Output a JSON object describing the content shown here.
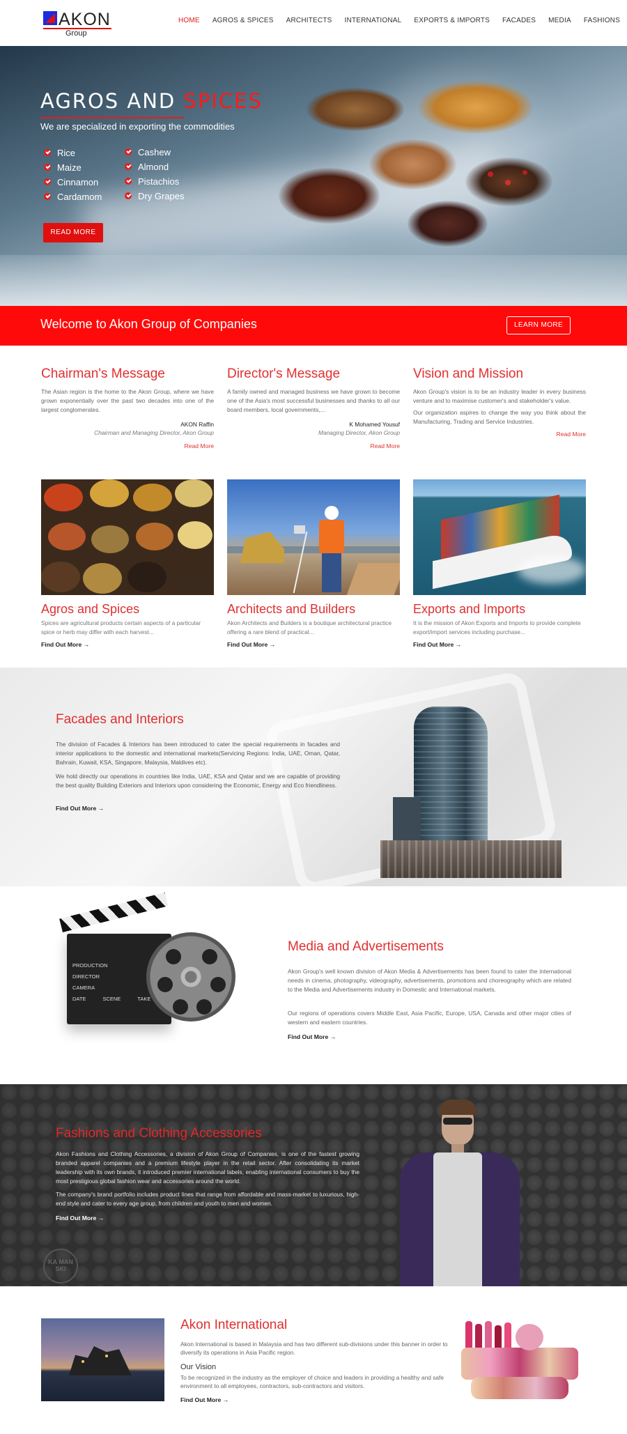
{
  "logo": {
    "word": "AKON",
    "group": "Group"
  },
  "nav": [
    "HOME",
    "AGROS & SPICES",
    "ARCHITECTS",
    "INTERNATIONAL",
    "EXPORTS & IMPORTS",
    "FACADES",
    "MEDIA",
    "FASHIONS"
  ],
  "hero": {
    "title_white": "AGROS AND",
    "title_red": "SPICES",
    "subtitle": "We are specialized in exporting the commodities",
    "list_left": [
      "Rice",
      "Maize",
      "Cinnamon",
      "Cardamom"
    ],
    "list_right": [
      "Cashew",
      "Almond",
      "Pistachios",
      "Dry Grapes"
    ],
    "button": "READ MORE"
  },
  "welcome": {
    "text": "Welcome to Akon Group of Companies",
    "button": "LEARN MORE"
  },
  "messages": [
    {
      "title": "Chairman's Message",
      "body": "The Asian region is the home to the Akon Group, where we have grown exponentially over the past two decades into one of the largest conglomerates.",
      "signature": "AKON Raffin",
      "role": "Chairman and Managing Director, Akon Group",
      "link": "Read More"
    },
    {
      "title": "Director's Message",
      "body": "A family owned and managed business we have grown to become one of the Asia's most successful businesses and thanks to all our board members, local governments,...",
      "signature": "K Mohamed Yousuf",
      "role": "Managing Director, Akon Group",
      "link": "Read More"
    },
    {
      "title": "Vision and Mission",
      "body": "Akon Group's vision is to be an industry leader in every business venture and to maximise customer's and stakeholder's value.",
      "body2": "Our organization aspires to change the way you think about the Manufacturing, Trading and Service Industries.",
      "link": "Read More"
    }
  ],
  "cards": [
    {
      "title": "Agros and Spices",
      "body": "Spices are agricultural products certain aspects of a particular spice or herb may differ with each harvest...",
      "link": "Find Out More →"
    },
    {
      "title": "Architects and Builders",
      "body": "Akon Architects and Builders is a boutique architectural practice offering a rare blend of practical...",
      "link": "Find Out More →"
    },
    {
      "title": "Exports and Imports",
      "body": "It is the mission of Akon Exports and Imports to provide complete export/import services including purchase...",
      "link": "Find Out More →"
    }
  ],
  "facades": {
    "title": "Facades and Interiors",
    "p1": "The division of Facades & Interiors has been introduced to cater the special requirements in facades and interior applications to the domestic and international markets(Servicing Regions: India, UAE, Oman, Qatar, Bahrain, Kuwait, KSA, Singapore, Malaysia, Maldives etc).",
    "p2": "We hold directly our operations in countries like India, UAE, KSA and Qatar and we are capable of providing the best quality Building Exteriors and Interiors upon considering the Economic, Energy and Eco friendliness.",
    "link": "Find Out More →"
  },
  "media": {
    "title": "Media and Advertisements",
    "p1": "Akon Group's well known division of Akon Media & Advertisements has been found to cater the international needs in cinema, photography, videography, advertisements, promotions and choreography which are related to the Media and Advertisements industry in Domestic and International markets.",
    "p2": "Our regions of operations covers Middle East, Asia Pacific, Europe, USA, Canada and other major cities of western and eastern countries.",
    "link": "Find Out More →",
    "clapper": [
      "PRODUCTION",
      "DIRECTOR",
      "CAMERA",
      "DATE",
      "SCENE",
      "TAKE"
    ]
  },
  "fashion": {
    "title": "Fashions and Clothing Accessories",
    "p1": "Akon Fashions and Clothing Accessories, a division of Akon Group of Companies, is one of the fastest growing branded apparel companies and a premium lifestyle player in the retail sector. After consolidating its market leadership with its own brands, it introduced premier international labels, enabling international consumers to buy the most prestigious global fashion wear and accessories around the world.",
    "p2": "The company's brand portfolio includes product lines that range from affordable and mass-market to luxurious, high-end style and cater to every age group, from children and youth to men and women.",
    "link": "Find Out More →",
    "badge": "KA MAN SKI"
  },
  "intl": {
    "title": "Akon International",
    "p1": "Akon International is based in Malaysia and has two different sub-divisions under this banner in order to diversify its operations in Asia Pacific region.",
    "vision_title": "Our Vision",
    "p2": "To be recognized in the industry as the employer of choice and leaders in providing a healthy and safe environment to all employees, contractors, sub-contractors and visitors.",
    "link": "Find Out More →"
  },
  "colors": {
    "accent": "#e03030",
    "bar": "#ff0a0a",
    "logo_blue": "#1a2be0"
  }
}
